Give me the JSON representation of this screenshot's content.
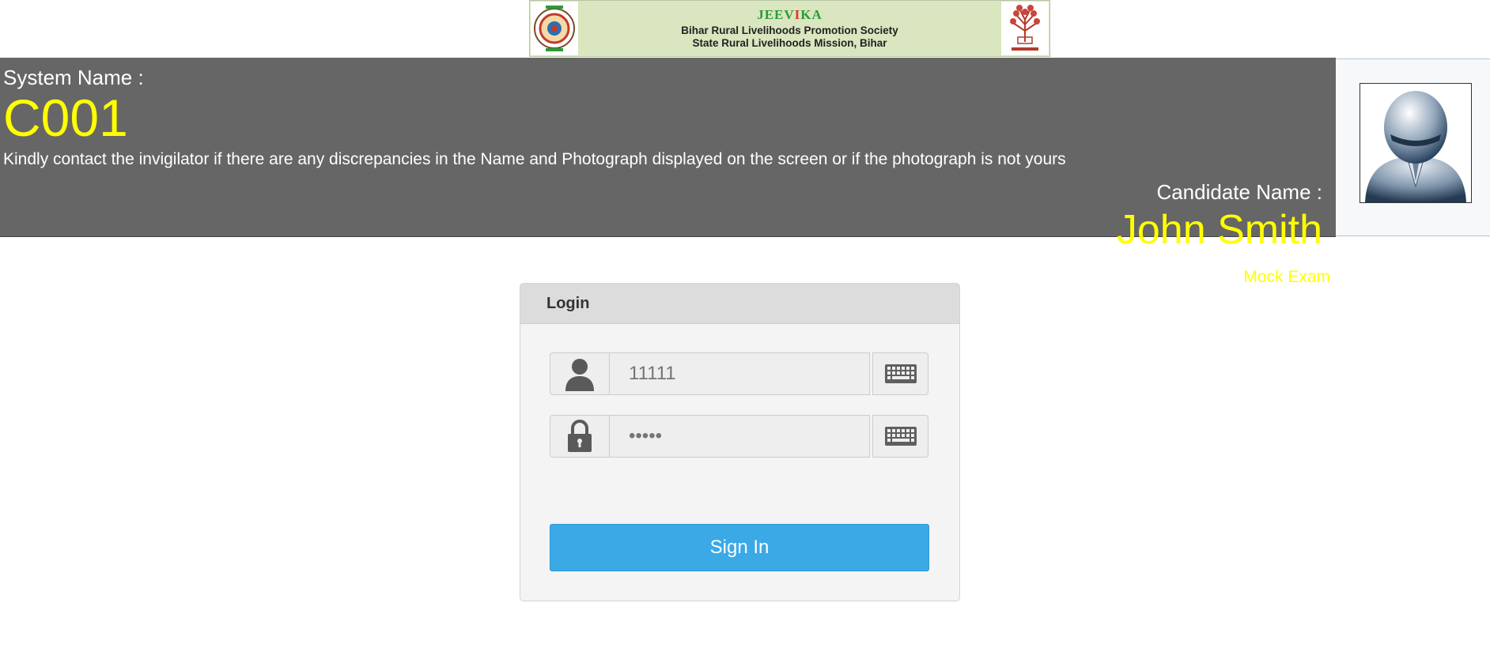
{
  "banner": {
    "title_part1": "JEEV",
    "title_part2": "I",
    "title_part3": "KA",
    "line1": "Bihar Rural Livelihoods Promotion Society",
    "line2": "State Rural Livelihoods Mission, Bihar"
  },
  "header": {
    "system_label": "System Name :",
    "system_value": "C001",
    "notice": "Kindly contact the invigilator if there are any discrepancies in the Name and Photograph displayed on the screen or if the photograph is not yours",
    "candidate_label": "Candidate Name :",
    "candidate_name": "John Smith",
    "exam_name": "Mock Exam"
  },
  "login": {
    "heading": "Login",
    "username_placeholder": "11111",
    "password_placeholder": "•••••",
    "submit_label": "Sign In"
  },
  "icons": {
    "user": "user-icon",
    "lock": "lock-icon",
    "keyboard": "keyboard-icon",
    "avatar": "avatar-icon"
  },
  "colors": {
    "header_bg": "#666666",
    "highlight_text": "#ffff00",
    "signin_button": "#3aa9e6",
    "banner_bg": "#d9e6bf"
  }
}
